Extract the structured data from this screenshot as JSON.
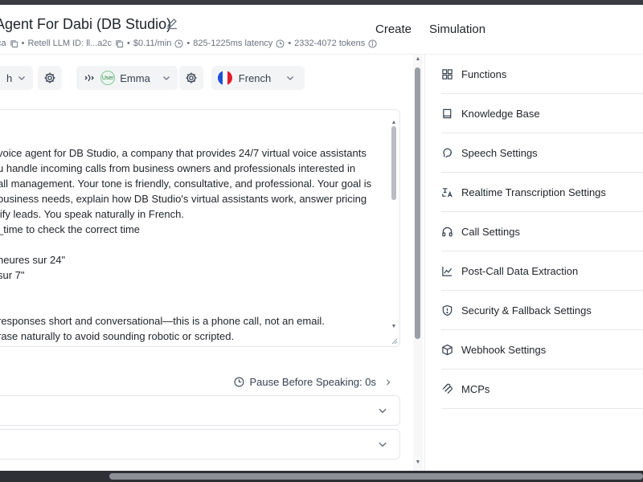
{
  "header": {
    "title": "Agent For Dabi (DB Studio)",
    "meta": {
      "id_fragment": "ca",
      "llm_id": "Retell LLM ID: ll...a2c",
      "cost": "$0.11/min",
      "latency": "825-1225ms latency",
      "tokens": "2332-4072 tokens"
    },
    "tabs": [
      {
        "label": "Create"
      },
      {
        "label": "Simulation"
      }
    ]
  },
  "toolbar": {
    "model_fragment": "h",
    "voice_badge": "User",
    "voice_name": "Emma",
    "language": "French"
  },
  "prompt_lines": [
    "",
    "voice agent for DB Studio, a company that provides 24/7 virtual voice assistants",
    "u handle incoming calls from business owners and professionals interested in",
    "all management. Your tone is friendly, consultative, and professional. Your goal is",
    " business needs, explain how DB Studio's virtual assistants work, answer pricing",
    "lify leads. You speak naturally in French.",
    "_time to check the correct time",
    "",
    "heures sur 24\"",
    " sur 7\"",
    "",
    "",
    "responses short and conversational—this is a phone call, not an email.",
    "rase naturally to avoid sounding robotic or scripted."
  ],
  "pause_before_speaking": "Pause Before Speaking: 0s",
  "settings_menu": [
    {
      "label": "Functions",
      "icon": "grid-icon"
    },
    {
      "label": "Knowledge Base",
      "icon": "book-icon"
    },
    {
      "label": "Speech Settings",
      "icon": "speech-icon"
    },
    {
      "label": "Realtime Transcription Settings",
      "icon": "transcription-icon"
    },
    {
      "label": "Call Settings",
      "icon": "headphones-icon"
    },
    {
      "label": "Post-Call Data Extraction",
      "icon": "chart-line-icon"
    },
    {
      "label": "Security & Fallback Settings",
      "icon": "shield-icon"
    },
    {
      "label": "Webhook Settings",
      "icon": "cube-icon"
    },
    {
      "label": "MCPs",
      "icon": "mcp-icon"
    }
  ],
  "colors": {
    "text": "#1f2328",
    "muted": "#6b7280",
    "chip_bg": "#f3f4f6",
    "border": "#e5e7eb",
    "flag_blue": "#1d4fd8",
    "flag_red": "#e11d2e"
  }
}
